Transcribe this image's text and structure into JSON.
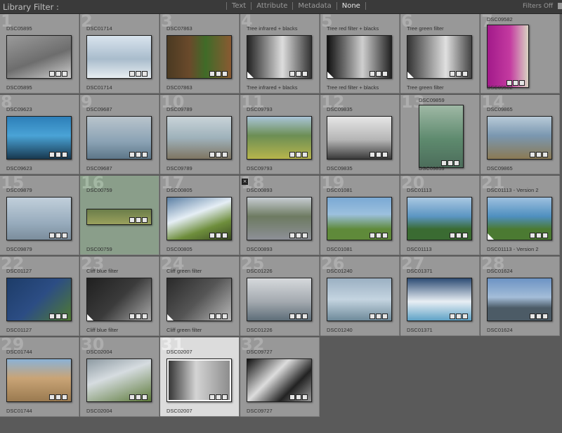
{
  "filter_bar": {
    "title": "Library Filter :",
    "options": [
      "Text",
      "Attribute",
      "Metadata",
      "None"
    ],
    "active_option": "None",
    "status": "Filters Off"
  },
  "grid": {
    "cells": [
      {
        "num": "1",
        "label": "DSC05895",
        "sublabel": "",
        "top_label": "DSC05895",
        "bottom_label": "DSC05895",
        "bg": "linear-gradient(160deg,#9a9a9a,#6d6d6d 55%,#cfcfcf)"
      },
      {
        "num": "2",
        "top_label": "DSC01714",
        "bottom_label": "DSC01714",
        "bg": "linear-gradient(180deg,#d9e4ee,#a9bccc 55%,#e8eef2)"
      },
      {
        "num": "3",
        "top_label": "DSC07863",
        "bottom_label": "DSC07863",
        "bg": "linear-gradient(90deg,#4b3a22,#6a4a2b 35%,#3f6b28 60%,#8a5a32)"
      },
      {
        "num": "4",
        "top_label": "Tree infrared + blacks",
        "bottom_label": "Tree infrared + blacks",
        "bg": "linear-gradient(90deg,#222,#888 30%,#ddd 55%,#333)"
      },
      {
        "num": "5",
        "top_label": "Tree red filter + blacks",
        "bottom_label": "Tree red filter + blacks",
        "bg": "linear-gradient(90deg,#111,#777 30%,#cfcfcf 55%,#222)"
      },
      {
        "num": "6",
        "top_label": "Tree green filter",
        "bottom_label": "Tree green filter",
        "bg": "linear-gradient(90deg,#333,#999 35%,#e0e0e0 60%,#444)"
      },
      {
        "num": "7",
        "top_label": "DSC09582",
        "bottom_label": "DSC09582",
        "bg": "linear-gradient(90deg,#a21a8a,#c43aa0 55%,#d9d3c2)"
      },
      {
        "num": "8",
        "top_label": "DSC09623",
        "bottom_label": "DSC09623",
        "bg": "linear-gradient(180deg,#2d7fb8,#4aa3d6 45%,#18384f)"
      },
      {
        "num": "9",
        "top_label": "DSC09687",
        "bottom_label": "DSC09687",
        "bg": "linear-gradient(180deg,#b9c4cc,#8aa2b4 60%,#5d7688)"
      },
      {
        "num": "10",
        "top_label": "DSC09789",
        "bottom_label": "DSC09789",
        "bg": "linear-gradient(180deg,#c9d3d8,#9fb2bb 50%,#7e7562)"
      },
      {
        "num": "11",
        "top_label": "DSC09793",
        "bottom_label": "DSC09793",
        "bg": "linear-gradient(180deg,#a9c4d8,#6c8e54 45%,#b7b54c)"
      },
      {
        "num": "12",
        "top_label": "DSC09835",
        "bottom_label": "DSC09835",
        "bg": "linear-gradient(180deg,#e6e6e6,#b5b5b5 55%,#3a3a3a)"
      },
      {
        "num": "13",
        "top_label": "DSC09859",
        "bottom_label": "DSC09859",
        "bg": "linear-gradient(180deg,#9fb8a5,#5e8a6e 55%,#4c6d5b)"
      },
      {
        "num": "14",
        "top_label": "DSC09865",
        "bottom_label": "DSC09865",
        "bg": "linear-gradient(180deg,#b8cad8,#7a97b0 45%,#8b7a54)"
      },
      {
        "num": "15",
        "top_label": "DSC09879",
        "bottom_label": "DSC09879",
        "bg": "linear-gradient(180deg,#c1cfdb,#98acbd 60%,#7b8d9c)"
      },
      {
        "num": "16",
        "top_label": "DSC00759",
        "bottom_label": "DSC00759",
        "bg": "linear-gradient(180deg,#6b7d4a,#9ba15d)"
      },
      {
        "num": "17",
        "top_label": "DSC00805",
        "bottom_label": "DSC00805",
        "bg": "linear-gradient(160deg,#5b7fa4,#e5eef5 40%,#6e8e3c 70%,#3a4b22)"
      },
      {
        "num": "18",
        "top_label": "DSC00893",
        "bottom_label": "DSC00893",
        "bg": "linear-gradient(180deg,#c6ccd2,#6d7a61 45%,#8d9097)"
      },
      {
        "num": "19",
        "top_label": "DSC01081",
        "bottom_label": "DSC01081",
        "bg": "linear-gradient(180deg,#7aa9d4,#9cc0de 40%,#5f8a3a 75%)"
      },
      {
        "num": "20",
        "top_label": "DSC01113",
        "bottom_label": "DSC01113",
        "bg": "linear-gradient(180deg,#aac8e2,#5b95c2 45%,#3a6b32 75%)"
      },
      {
        "num": "21",
        "top_label": "DSC01113 - Version 2",
        "bottom_label": "DSC01113 - Version 2",
        "bg": "linear-gradient(180deg,#9ec0df,#4e8fbf 45%,#4b7a32 75%)"
      },
      {
        "num": "22",
        "top_label": "DSC01127",
        "bottom_label": "DSC01127",
        "bg": "linear-gradient(135deg,#1d3c68,#2c4d84 50%,#507a32)"
      },
      {
        "num": "23",
        "top_label": "Cliff blue filter",
        "bottom_label": "Cliff blue filter",
        "bg": "linear-gradient(135deg,#202020,#3b3b3b 50%,#a8a8a8)"
      },
      {
        "num": "24",
        "top_label": "Cliff green filter",
        "bottom_label": "Cliff green filter",
        "bg": "linear-gradient(135deg,#2a2a2a,#555 50%,#b8b8b8)"
      },
      {
        "num": "25",
        "top_label": "DSC01226",
        "bottom_label": "DSC01226",
        "bg": "linear-gradient(180deg,#d6d9dc,#a4aab0 55%,#5d6d78)"
      },
      {
        "num": "26",
        "top_label": "DSC01240",
        "bottom_label": "DSC01240",
        "bg": "linear-gradient(180deg,#9bb0c2,#c4d4e0 50%,#6e8a9a)"
      },
      {
        "num": "27",
        "top_label": "DSC01371",
        "bottom_label": "DSC01371",
        "bg": "linear-gradient(180deg,#2d4c74,#e8eef4 55%,#5ea2c6)"
      },
      {
        "num": "28",
        "top_label": "DSC01624",
        "bottom_label": "DSC01624",
        "bg": "linear-gradient(180deg,#6c93c4,#a4bdd8 45%,#4c5b66 70%)"
      },
      {
        "num": "29",
        "top_label": "DSC01744",
        "bottom_label": "DSC01744",
        "bg": "linear-gradient(180deg,#8bb2d6,#c9a476 45%,#9a7a50)"
      },
      {
        "num": "30",
        "top_label": "DSC02004",
        "bottom_label": "DSC02004",
        "bg": "linear-gradient(160deg,#8d9aa2,#d6dce0 40%,#5d7a3a)"
      },
      {
        "num": "31",
        "top_label": "DSC02007",
        "bottom_label": "DSC02007",
        "bg": "linear-gradient(90deg,#2e2e2e,#d4d4d4 45%,#8a8a8a)"
      },
      {
        "num": "32",
        "top_label": "DSC09727",
        "bottom_label": "DSC09727",
        "bg": "linear-gradient(135deg,#111,#ddd 40%,#222 70%,#999)"
      }
    ]
  }
}
